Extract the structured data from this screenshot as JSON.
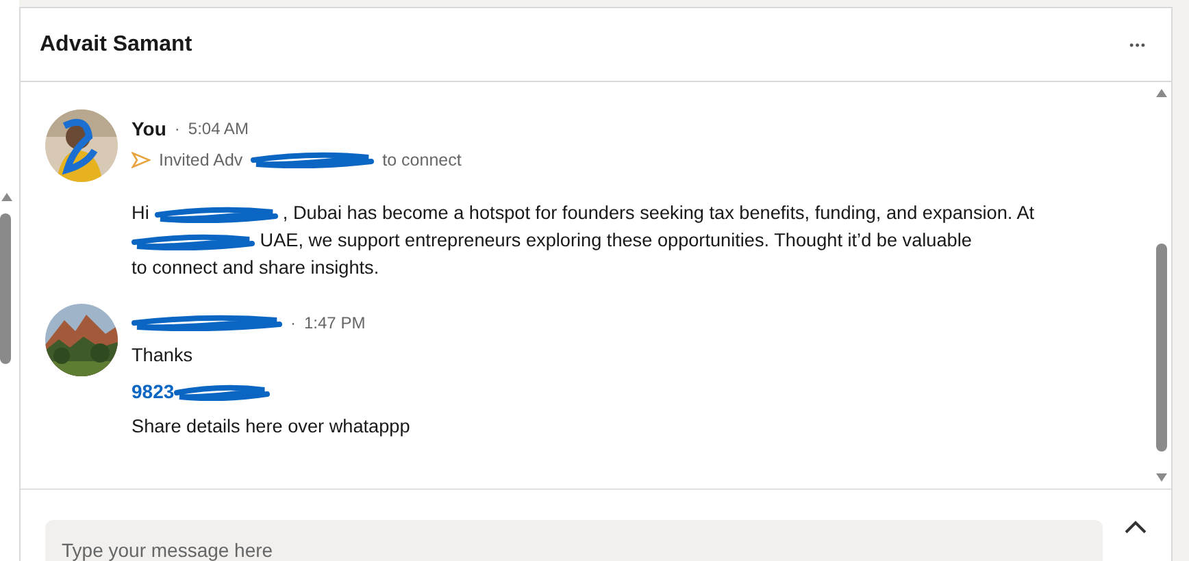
{
  "conversation": {
    "title": "Advait Samant",
    "menu": "•••"
  },
  "messages": [
    {
      "avatar": {
        "kind": "picture"
      },
      "sender": [
        {
          "kind": "text",
          "text": "You"
        }
      ],
      "separator": "·",
      "time": "5:04 AM",
      "blocks": [
        {
          "kind": "invite",
          "segments": [
            {
              "kind": "text",
              "text": "Invited Adv"
            },
            {
              "kind": "redacted"
            },
            {
              "kind": "text",
              "text": "to connect"
            }
          ]
        },
        {
          "kind": "paragraph",
          "segments": [
            {
              "kind": "text",
              "text": "Hi"
            },
            {
              "kind": "redacted"
            },
            {
              "kind": "text",
              "text": ", Dubai has become a hotspot for founders seeking tax benefits, funding, and expansion. At"
            },
            {
              "kind": "redacted"
            },
            {
              "kind": "text",
              "text": "UAE, we support entrepreneurs exploring these opportunities. Thought it’d be valuable"
            },
            {
              "kind": "text",
              "text": "to connect and share insights."
            }
          ]
        }
      ]
    },
    {
      "avatar": {
        "kind": "picture"
      },
      "sender": [
        {
          "kind": "redacted"
        }
      ],
      "separator": "·",
      "time": "1:47 PM",
      "blocks": [
        {
          "kind": "paragraph",
          "segments": [
            {
              "kind": "text",
              "text": "Thanks"
            }
          ]
        },
        {
          "kind": "link",
          "segments": [
            {
              "kind": "text",
              "text": "9823"
            },
            {
              "kind": "redacted"
            }
          ]
        },
        {
          "kind": "paragraph",
          "segments": [
            {
              "kind": "text",
              "text": "Share details here over whatappp"
            }
          ]
        }
      ]
    }
  ],
  "composer": {
    "placeholder": "Type your message here"
  }
}
